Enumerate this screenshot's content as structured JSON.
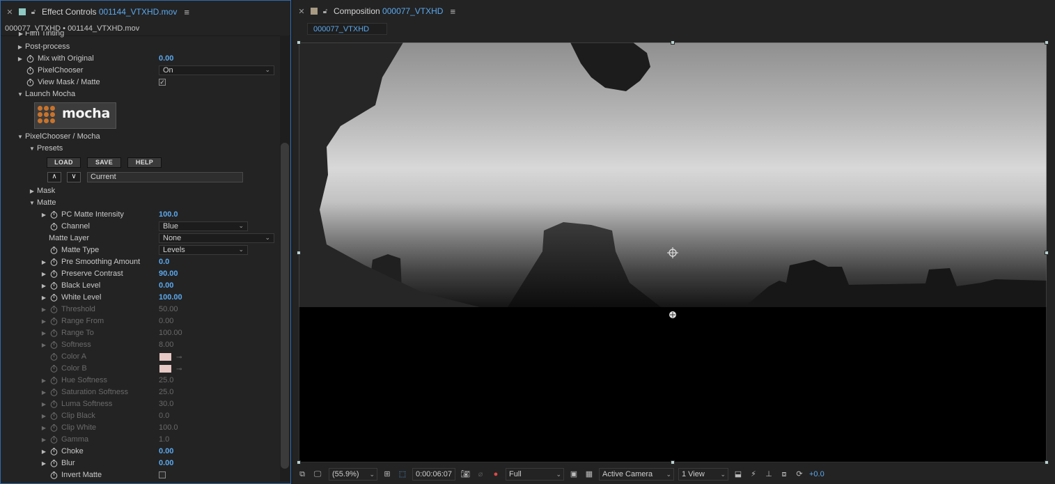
{
  "left_panel": {
    "header": {
      "prefix": "Effect Controls",
      "file": "001144_VTXHD.mov"
    },
    "subtitle": "000077_VTXHD • 001144_VTXHD.mov",
    "partial_row": "Film Tinting",
    "rows": [
      {
        "label": "Post-process"
      },
      {
        "label": "Mix with Original",
        "value": "0.00"
      },
      {
        "label": "PixelChooser",
        "dropdown": "On"
      },
      {
        "label": "View Mask / Matte",
        "checkbox": "✓"
      },
      {
        "label": "Launch Mocha"
      },
      {
        "label": "PixelChooser / Mocha"
      },
      {
        "label": "Presets"
      },
      {
        "label": "Mask"
      },
      {
        "label": "Matte"
      },
      {
        "label": "PC Matte Intensity",
        "value": "100.0"
      },
      {
        "label": "Channel",
        "dropdown": "Blue"
      },
      {
        "label": "Matte Layer",
        "dropdown": "None"
      },
      {
        "label": "Matte Type",
        "dropdown": "Levels"
      },
      {
        "label": "Pre Smoothing Amount",
        "value": "0.0"
      },
      {
        "label": "Preserve Contrast",
        "value": "90.00"
      },
      {
        "label": "Black Level",
        "value": "0.00"
      },
      {
        "label": "White Level",
        "value": "100.00"
      },
      {
        "label": "Threshold",
        "value": "50.00"
      },
      {
        "label": "Range From",
        "value": "0.00"
      },
      {
        "label": "Range To",
        "value": "100.00"
      },
      {
        "label": "Softness",
        "value": "8.00"
      },
      {
        "label": "Color A"
      },
      {
        "label": "Color B"
      },
      {
        "label": "Hue Softness",
        "value": "25.0"
      },
      {
        "label": "Saturation Softness",
        "value": "25.0"
      },
      {
        "label": "Luma Softness",
        "value": "30.0"
      },
      {
        "label": "Clip Black",
        "value": "0.0"
      },
      {
        "label": "Clip White",
        "value": "100.0"
      },
      {
        "label": "Gamma",
        "value": "1.0"
      },
      {
        "label": "Choke",
        "value": "0.00"
      },
      {
        "label": "Blur",
        "value": "0.00"
      },
      {
        "label": "Invert Matte"
      }
    ],
    "mocha_label": "mocha",
    "preset_buttons": {
      "load": "LOAD",
      "save": "SAVE",
      "help": "HELP"
    },
    "preset_up": "∧",
    "preset_down": "∨",
    "preset_current": "Current",
    "colors": {
      "color_a": "#e6c8c4",
      "color_b": "#e6c8c4",
      "accent": "#5aa9f0",
      "mocha_dots": "#c8732b"
    }
  },
  "right_panel": {
    "header": {
      "prefix": "Composition",
      "name": "000077_VTXHD"
    },
    "tab": "000077_VTXHD",
    "footer": {
      "zoom": "(55.9%)",
      "timecode": "0:00:06:07",
      "resolution": "Full",
      "camera": "Active Camera",
      "views": "1 View",
      "exposure": "+0.0"
    }
  }
}
